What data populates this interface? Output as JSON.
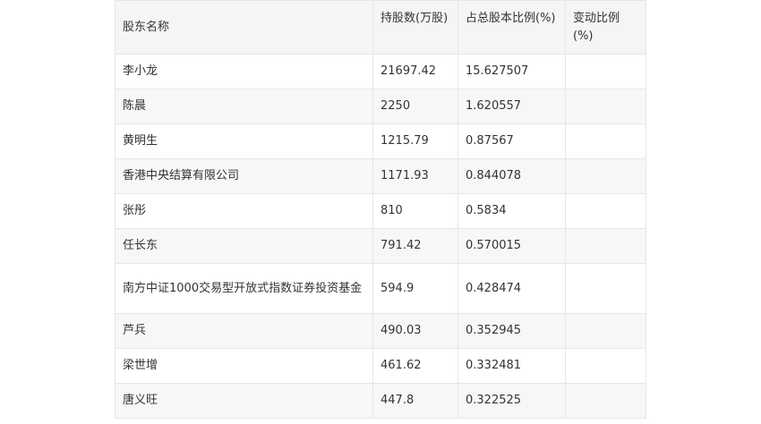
{
  "table": {
    "headers": [
      "股东名称",
      "持股数(万股)",
      "占总股本比例(%)",
      "变动比例(%)"
    ],
    "rows": [
      [
        "李小龙",
        "21697.42",
        "15.627507",
        ""
      ],
      [
        "陈晨",
        "2250",
        "1.620557",
        ""
      ],
      [
        "黄明生",
        "1215.79",
        "0.87567",
        ""
      ],
      [
        "香港中央结算有限公司",
        "1171.93",
        "0.844078",
        ""
      ],
      [
        "张彤",
        "810",
        "0.5834",
        ""
      ],
      [
        "任长东",
        "791.42",
        "0.570015",
        ""
      ],
      [
        "南方中证1000交易型开放式指数证券投资基金",
        "594.9",
        "0.428474",
        ""
      ],
      [
        "芦兵",
        "490.03",
        "0.352945",
        ""
      ],
      [
        "梁世增",
        "461.62",
        "0.332481",
        ""
      ],
      [
        "唐义旺",
        "447.8",
        "0.322525",
        ""
      ]
    ]
  }
}
